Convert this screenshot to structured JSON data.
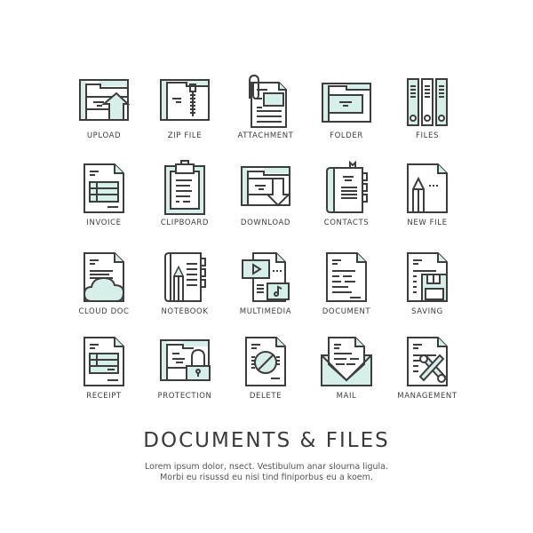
{
  "accent_color": "#d6efe9",
  "line_color": "#3d3d3d",
  "icons": [
    {
      "label": "UPLOAD",
      "icon": "upload-icon"
    },
    {
      "label": "ZIP FILE",
      "icon": "zip-file-icon"
    },
    {
      "label": "ATTACHMENT",
      "icon": "attachment-icon"
    },
    {
      "label": "FOLDER",
      "icon": "folder-icon"
    },
    {
      "label": "FILES",
      "icon": "files-icon"
    },
    {
      "label": "INVOICE",
      "icon": "invoice-icon"
    },
    {
      "label": "CLIPBOARD",
      "icon": "clipboard-icon"
    },
    {
      "label": "DOWNLOAD",
      "icon": "download-icon"
    },
    {
      "label": "CONTACTS",
      "icon": "contacts-icon"
    },
    {
      "label": "NEW FILE",
      "icon": "new-file-icon"
    },
    {
      "label": "CLOUD DOC",
      "icon": "cloud-doc-icon"
    },
    {
      "label": "NOTEBOOK",
      "icon": "notebook-icon"
    },
    {
      "label": "MULTIMEDIA",
      "icon": "multimedia-icon"
    },
    {
      "label": "DOCUMENT",
      "icon": "document-icon"
    },
    {
      "label": "SAVING",
      "icon": "saving-icon"
    },
    {
      "label": "RECEIPT",
      "icon": "receipt-icon"
    },
    {
      "label": "PROTECTION",
      "icon": "protection-icon"
    },
    {
      "label": "DELETE",
      "icon": "delete-icon"
    },
    {
      "label": "MAIL",
      "icon": "mail-icon"
    },
    {
      "label": "MANAGEMENT",
      "icon": "management-icon"
    }
  ],
  "title": "DOCUMENTS & FILES",
  "subtitle_line1": "Lorem ipsum dolor, nsect. Vestibulum anar slourna ligula.",
  "subtitle_line2": "Morbi eu risussd eu nisi tind finiporbus eu a koem."
}
